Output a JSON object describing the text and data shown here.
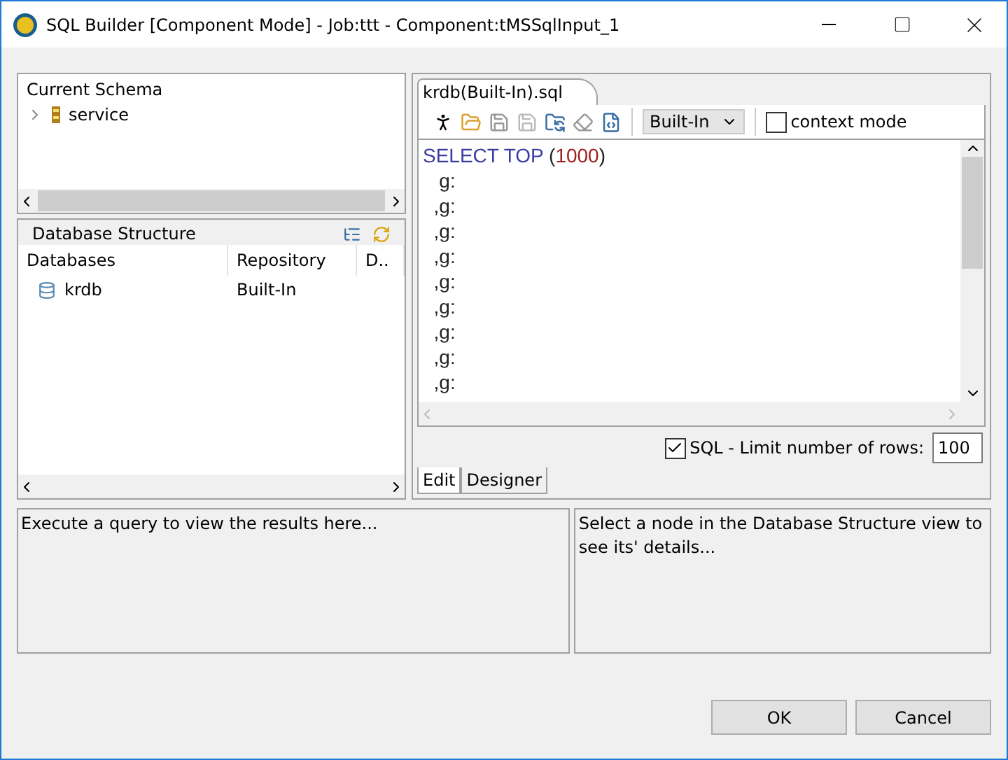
{
  "window": {
    "title": "SQL Builder [Component Mode] - Job:ttt - Component:tMSSqlInput_1"
  },
  "schema_panel": {
    "title": "Current Schema",
    "items": [
      {
        "label": "service",
        "expanded": false
      }
    ]
  },
  "db_structure": {
    "title": "Database Structure",
    "columns": [
      "Databases",
      "Repository",
      "D.."
    ],
    "rows": [
      {
        "cells": [
          "krdb",
          "Built-In",
          ""
        ]
      }
    ]
  },
  "editor": {
    "tab": "krdb(Built-In).sql",
    "dropdown": "Built-In",
    "context_mode": {
      "label": "context mode",
      "checked": false
    },
    "lines": [
      [
        {
          "kind": "keyword",
          "text": "SELECT TOP"
        },
        {
          "kind": "plain",
          "text": " ("
        },
        {
          "kind": "number",
          "text": "1000"
        },
        {
          "kind": "plain",
          "text": ")"
        }
      ],
      [
        {
          "kind": "plain",
          "text": "   g:"
        }
      ],
      [
        {
          "kind": "plain",
          "text": "  ,g:"
        }
      ],
      [
        {
          "kind": "plain",
          "text": "  ,g:"
        }
      ],
      [
        {
          "kind": "plain",
          "text": "  ,g:"
        }
      ],
      [
        {
          "kind": "plain",
          "text": "  ,g:"
        }
      ],
      [
        {
          "kind": "plain",
          "text": "  ,g:"
        }
      ],
      [
        {
          "kind": "plain",
          "text": "  ,g:"
        }
      ],
      [
        {
          "kind": "plain",
          "text": "  ,g:"
        }
      ],
      [
        {
          "kind": "plain",
          "text": "  ,g:"
        }
      ]
    ],
    "limit": {
      "label": "SQL - Limit number of rows:",
      "checked": true,
      "value": "100"
    },
    "tabs": [
      {
        "label": "Edit",
        "selected": true
      },
      {
        "label": "Designer",
        "selected": false
      }
    ]
  },
  "results_text": "Execute a query to view the results here...",
  "details_text": "Select a node in the Database Structure view to see its' details...",
  "buttons": [
    "OK",
    "Cancel"
  ]
}
